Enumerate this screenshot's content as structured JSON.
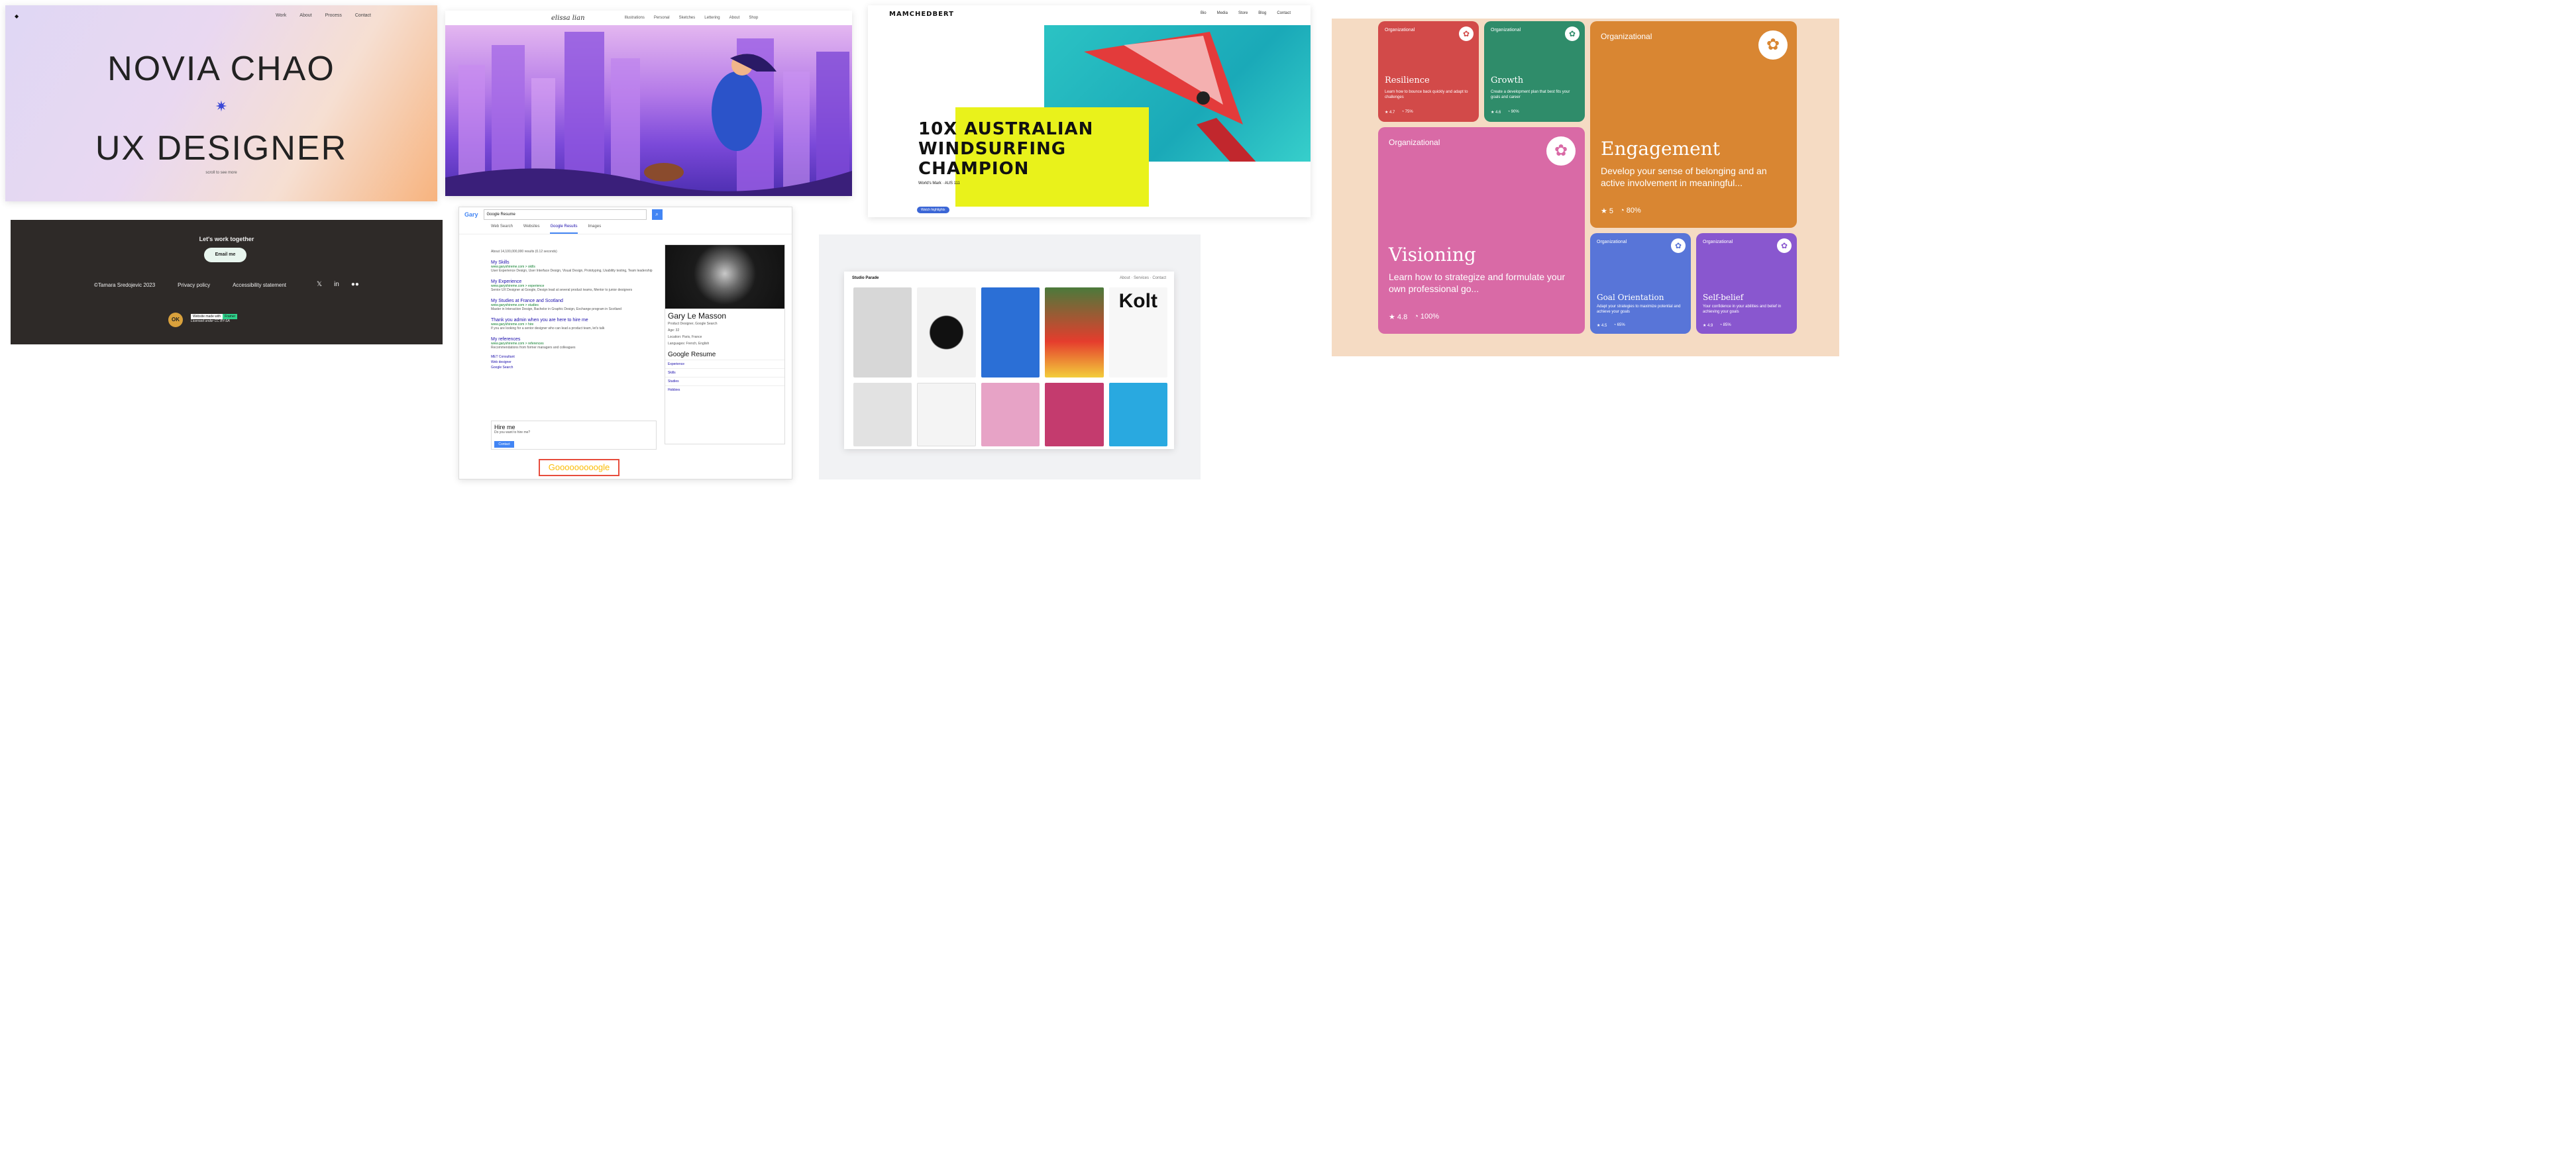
{
  "novia": {
    "logo": "◆",
    "nav": [
      "Work",
      "About",
      "Process",
      "Contact"
    ],
    "title1": "NOVIA CHAO",
    "star": "✷",
    "title2": "UX DESIGNER",
    "subtitle": "scroll to see more"
  },
  "footer": {
    "headline": "Let's work together",
    "button": "Email me",
    "copyright": "©Tamara Sredojevic 2023",
    "privacy": "Privacy policy",
    "accessibility": "Accessibility statement",
    "social": [
      "𝕏",
      "in",
      "●●"
    ],
    "avatar": "OK",
    "credit_a": "Website made with",
    "credit_b": "Framer",
    "credit_c": "Licensed under CC BY-SA"
  },
  "illustration": {
    "brand": "elissa lian",
    "menu": [
      "Illustrations",
      "Personal",
      "Sketches",
      "Lettering",
      "About",
      "Shop"
    ]
  },
  "windsurf": {
    "brand": "MAMCHEDBERT",
    "nav": [
      "Bio",
      "Media",
      "Store",
      "Blog",
      "Contact"
    ],
    "title": [
      "10X AUSTRALIAN",
      "WINDSURFING",
      "CHAMPION"
    ],
    "tagline": "World's Mark · AUS 111",
    "pill": "Watch highlights"
  },
  "google": {
    "logo": "Gary",
    "query": "Google Resume",
    "tabs": [
      "Web Search",
      "Websites",
      "Google Results",
      "Images"
    ],
    "stats": "About 14,100,000,000 results (0.12 seconds)",
    "results": [
      {
        "title": "My Skills",
        "url": "www.garyshireme.com > skills",
        "snippet": "User Experience Design, User Interface Design, Visual Design, Prototyping, Usability testing, Team leadership"
      },
      {
        "title": "My Experience",
        "url": "www.garyshireme.com > experience",
        "snippet": "Senior UX Designer at Google, Design lead at several product teams, Mentor to junior designers"
      },
      {
        "title": "My Studies at France and Scotland",
        "url": "www.garyshireme.com > studies",
        "snippet": "Master in Interaction Design, Bachelor in Graphic Design, Exchange program in Scotland"
      },
      {
        "title": "Thank you admin when you are here to hire me",
        "url": "www.garyshireme.com > hire",
        "snippet": "If you are looking for a senior designer who can lead a product team, let's talk"
      },
      {
        "title": "My references",
        "url": "www.garyshireme.com > references",
        "snippet": "Recommendations from former managers and colleagues"
      }
    ],
    "links": [
      "MET Consultant",
      "Web designer",
      "Google Search"
    ],
    "panel": {
      "name": "Gary Le Masson",
      "role": "Product Designer, Google Search",
      "age": "Age: 32",
      "location": "Location: Paris, France",
      "languages": "Languages: French, English",
      "resume_title": "Google Resume",
      "items": [
        "Experience",
        "Skills",
        "Studies",
        "Hobbies"
      ]
    },
    "hire_title": "Hire me",
    "hire_sub": "Do you want to hire me?",
    "hire_button": "Contact",
    "footer": "Gooooooooogle"
  },
  "studio": {
    "brand": "Studio Parade",
    "right": "About · Services · Contact",
    "kolt": "Kolt"
  },
  "courses": [
    {
      "label": "Organizational",
      "title": "Resilience",
      "desc": "Learn how to bounce back quickly and adapt to challenges",
      "meta": [
        "★ 4.7",
        "◔ 75%"
      ],
      "icon": "✿"
    },
    {
      "label": "Organizational",
      "title": "Growth",
      "desc": "Create a development plan that best fits your goals and career",
      "meta": [
        "★ 4.6",
        "◔ 90%"
      ],
      "icon": "✿"
    },
    {
      "label": "Organizational",
      "title": "Engagement",
      "desc": "Develop your sense of belonging and an active involvement in meaningful...",
      "meta": [
        "★ 5",
        "◔ 80%"
      ],
      "icon": "✿"
    },
    {
      "label": "Organizational",
      "title": "Visioning",
      "desc": "Learn how to strategize and formulate your own professional go...",
      "meta": [
        "★ 4.8",
        "◔ 100%"
      ],
      "icon": "✿"
    },
    {
      "label": "Organizational",
      "title": "Goal Orientation",
      "desc": "Adapt your strategies to maximize potential and achieve your goals",
      "meta": [
        "★ 4.5",
        "◔ 65%"
      ],
      "icon": "✿"
    },
    {
      "label": "Organizational",
      "title": "Self-belief",
      "desc": "Your confidence in your abilities and belief in achieving your goals",
      "meta": [
        "★ 4.9",
        "◔ 85%"
      ],
      "icon": "✿"
    }
  ]
}
